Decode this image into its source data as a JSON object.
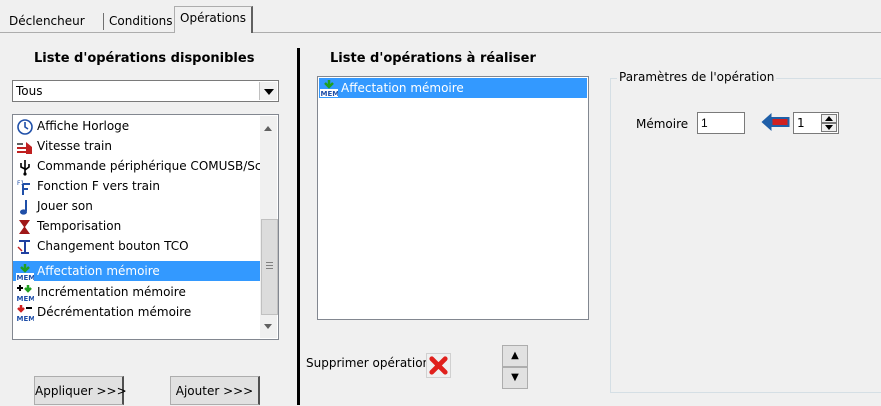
{
  "tabs": [
    {
      "label": "Déclencheur"
    },
    {
      "label": "Conditions"
    },
    {
      "label": "Opérations",
      "active": true
    }
  ],
  "available": {
    "title": "Liste d'opérations disponibles",
    "filter_value": "Tous",
    "items": [
      {
        "label": "Affiche Horloge",
        "icon": "clock-icon"
      },
      {
        "label": "Vitesse train",
        "icon": "train-speed-icon"
      },
      {
        "label": "Commande périphérique COMUSB/Sc",
        "icon": "usb-icon"
      },
      {
        "label": "Fonction F vers train",
        "icon": "function-f-icon"
      },
      {
        "label": "Jouer son",
        "icon": "music-note-icon"
      },
      {
        "label": "Temporisation",
        "icon": "hourglass-icon"
      },
      {
        "label": "Changement bouton TCO",
        "icon": "tco-button-icon"
      },
      {
        "label": "Affectation mémoire",
        "icon": "memory-assign-icon",
        "selected": true
      },
      {
        "label": "Incrémentation mémoire",
        "icon": "memory-increment-icon"
      },
      {
        "label": "Décrémentation mémoire",
        "icon": "memory-decrement-icon"
      }
    ],
    "apply_label": "Appliquer >>>",
    "add_label": "Ajouter >>>"
  },
  "todo": {
    "title": "Liste d'opérations à réaliser",
    "items": [
      {
        "label": "Affectation mémoire",
        "icon": "memory-assign-icon",
        "selected": true
      }
    ],
    "delete_label": "Supprimer opération",
    "up_label": "▲",
    "down_label": "▼"
  },
  "params": {
    "title": "Paramètres de l'opération",
    "memory_label": "Mémoire",
    "memory_value": "1",
    "spin_value": "1"
  },
  "colors": {
    "selection": "#3399ff",
    "delete_red": "#e0201c",
    "arrow_blue": "#1f5fa8",
    "arrow_red": "#d02020"
  }
}
